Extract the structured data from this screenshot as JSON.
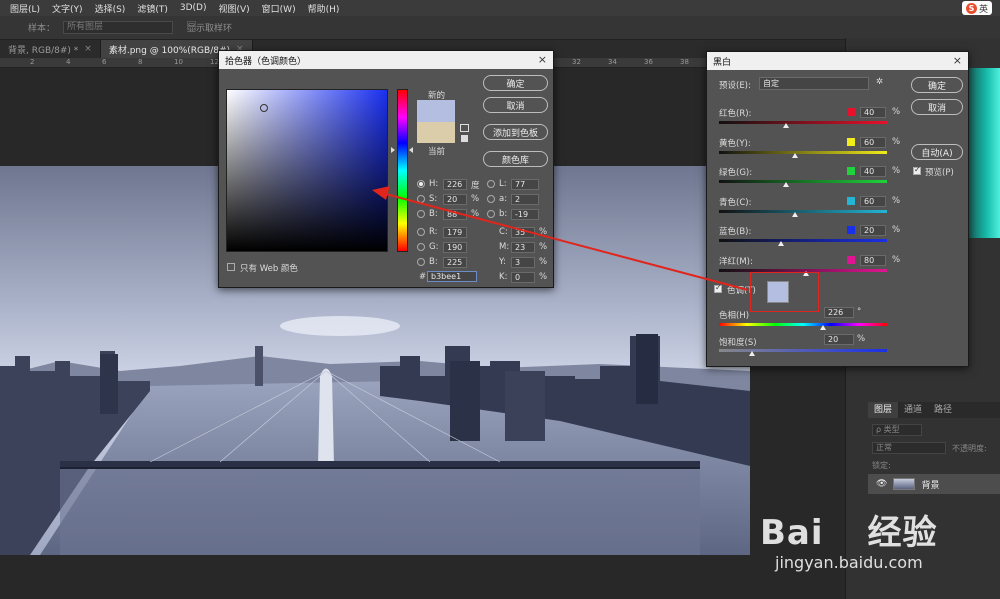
{
  "menubar": {
    "items": [
      "图层(L)",
      "文字(Y)",
      "选择(S)",
      "滤镜(T)",
      "3D(D)",
      "视图(V)",
      "窗口(W)",
      "帮助(H)"
    ],
    "ime_label": "英",
    "ime_logo": "S"
  },
  "options_bar": {
    "sample_label": "样本：",
    "sample_value": "所有图层",
    "show_ring_label": "显示取样环"
  },
  "tabs": [
    {
      "label": "背景, RGB/8#) *",
      "close": "×",
      "active": false
    },
    {
      "label": "素材.png @ 100%(RGB/8#)",
      "close": "×",
      "active": true
    }
  ],
  "ruler": {
    "ticks": [
      "2",
      "4",
      "6",
      "8",
      "10",
      "12",
      "14",
      "16",
      "18",
      "20",
      "22",
      "24",
      "26",
      "28",
      "30",
      "32",
      "34",
      "36",
      "38",
      "40",
      "42",
      "44"
    ]
  },
  "color_picker": {
    "title": "拾色器（色调颜色）",
    "close": "×",
    "new_label": "新的",
    "current_label": "当前",
    "ok": "确定",
    "cancel": "取消",
    "add_swatch": "添加到色板",
    "color_library": "颜色库",
    "only_web": "只有 Web 颜色",
    "hsb": [
      {
        "key": "H:",
        "value": "226",
        "unit": "度"
      },
      {
        "key": "S:",
        "value": "20",
        "unit": "%"
      },
      {
        "key": "B:",
        "value": "88",
        "unit": "%"
      }
    ],
    "rgb": [
      {
        "key": "R:",
        "value": "179"
      },
      {
        "key": "G:",
        "value": "190"
      },
      {
        "key": "B:",
        "value": "225"
      }
    ],
    "lab": [
      {
        "key": "L:",
        "value": "77"
      },
      {
        "key": "a:",
        "value": "2"
      },
      {
        "key": "b:",
        "value": "-19"
      }
    ],
    "cmyk": [
      {
        "key": "C:",
        "value": "35",
        "unit": "%"
      },
      {
        "key": "M:",
        "value": "23",
        "unit": "%"
      },
      {
        "key": "Y:",
        "value": "3",
        "unit": "%"
      },
      {
        "key": "K:",
        "value": "0",
        "unit": "%"
      }
    ],
    "hex_label": "#",
    "hex_value": "b3bee1",
    "new_color": "#b3bee1",
    "current_color": "#dccdaa"
  },
  "bw": {
    "title": "黑白",
    "close": "×",
    "preset_label": "预设(E):",
    "preset_value": "自定",
    "ok": "确定",
    "cancel": "取消",
    "auto": "自动(A)",
    "preview": "预览(P)",
    "percent": "%",
    "sliders": [
      {
        "label": "红色(R):",
        "value": "40",
        "color": "#e8102a",
        "fraction": 0.4
      },
      {
        "label": "黄色(Y):",
        "value": "60",
        "color": "#f2ec18",
        "fraction": 0.45
      },
      {
        "label": "绿色(G):",
        "value": "40",
        "color": "#1ed43a",
        "fraction": 0.4
      },
      {
        "label": "青色(C):",
        "value": "60",
        "color": "#22b5d6",
        "fraction": 0.45
      },
      {
        "label": "蓝色(B):",
        "value": "20",
        "color": "#1a2fe8",
        "fraction": 0.37
      },
      {
        "label": "洋红(M):",
        "value": "80",
        "color": "#e01492",
        "fraction": 0.52
      }
    ],
    "tint_label": "色调(T)",
    "hue_label": "色相(H)",
    "hue_value": "226",
    "hue_unit": "°",
    "sat_label": "饱和度(S)",
    "sat_value": "20",
    "sat_unit": "%",
    "tint_color": "#b3bee1"
  },
  "right_panel": {
    "tabs": [
      "图层",
      "通道",
      "路径"
    ],
    "kind_label": "ρ 类型",
    "blend_mode": "正常",
    "opacity_label": "不透明度:",
    "lock_label": "锁定:",
    "layer_name": "背景"
  },
  "watermark": {
    "brand": "Bai",
    "brand2": "经验",
    "url": "jingyan.baidu.com"
  }
}
